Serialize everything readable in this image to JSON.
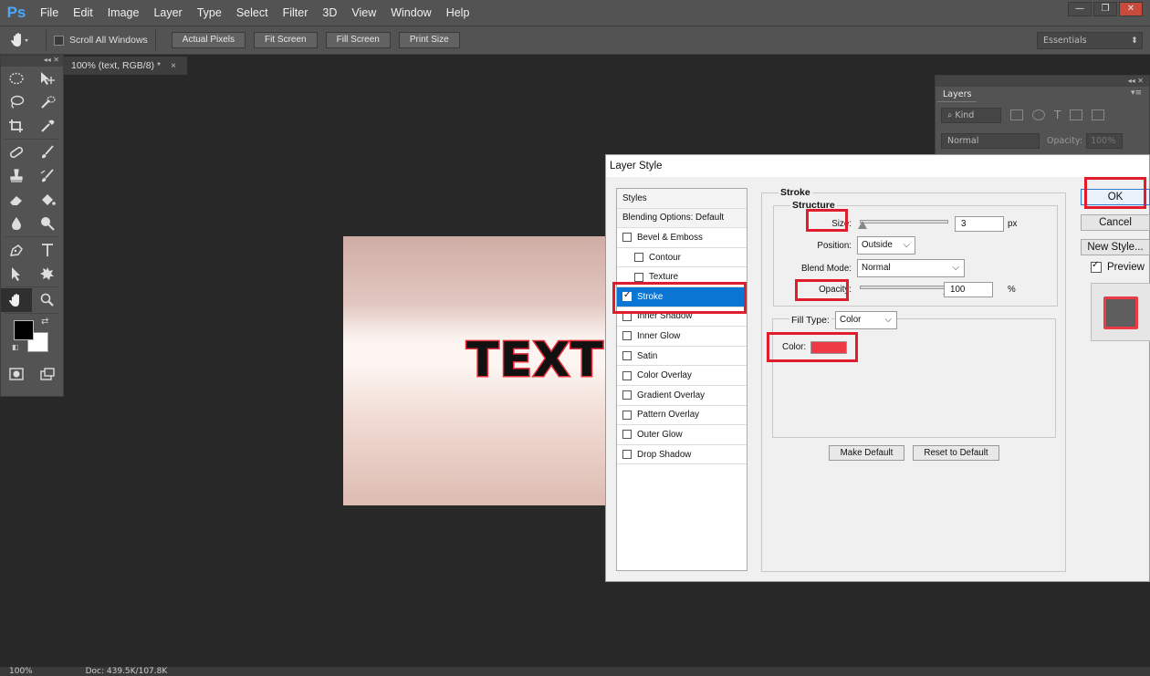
{
  "app": {
    "logo": "Ps"
  },
  "menu": [
    "File",
    "Edit",
    "Image",
    "Layer",
    "Type",
    "Select",
    "Filter",
    "3D",
    "View",
    "Window",
    "Help"
  ],
  "window_controls": {
    "minimize": "—",
    "restore": "❐",
    "close": "✕"
  },
  "options_bar": {
    "scroll_all_windows": "Scroll All Windows",
    "buttons": [
      "Actual Pixels",
      "Fit Screen",
      "Fill Screen",
      "Print Size"
    ],
    "workspace": "Essentials"
  },
  "document_tab": {
    "title": "100% (text, RGB/8) *",
    "close": "×"
  },
  "canvas": {
    "text": "TEXT",
    "stroke_color": "#e52e3a"
  },
  "layers_panel": {
    "title": "Layers",
    "kind": "Kind",
    "blend_mode": "Normal",
    "opacity_label": "Opacity:",
    "opacity_value": "100%"
  },
  "status_bar": {
    "zoom": "100%",
    "doc": "Doc: 439.5K/107.8K"
  },
  "dialog": {
    "title": "Layer Style",
    "styles": [
      {
        "label": "Styles",
        "type": "head"
      },
      {
        "label": "Blending Options: Default",
        "type": "head"
      },
      {
        "label": "Bevel & Emboss",
        "type": "check",
        "checked": false
      },
      {
        "label": "Contour",
        "type": "sub",
        "checked": false
      },
      {
        "label": "Texture",
        "type": "sub",
        "checked": false
      },
      {
        "label": "Stroke",
        "type": "check",
        "checked": true,
        "selected": true
      },
      {
        "label": "Inner Shadow",
        "type": "check",
        "checked": false
      },
      {
        "label": "Inner Glow",
        "type": "check",
        "checked": false
      },
      {
        "label": "Satin",
        "type": "check",
        "checked": false
      },
      {
        "label": "Color Overlay",
        "type": "check",
        "checked": false
      },
      {
        "label": "Gradient Overlay",
        "type": "check",
        "checked": false
      },
      {
        "label": "Pattern Overlay",
        "type": "check",
        "checked": false
      },
      {
        "label": "Outer Glow",
        "type": "check",
        "checked": false
      },
      {
        "label": "Drop Shadow",
        "type": "check",
        "checked": false
      }
    ],
    "stroke": {
      "group_title": "Stroke",
      "structure_title": "Structure",
      "size_label": "Size:",
      "size_value": "3",
      "size_unit": "px",
      "position_label": "Position:",
      "position_value": "Outside",
      "blend_mode_label": "Blend Mode:",
      "blend_mode_value": "Normal",
      "opacity_label": "Opacity:",
      "opacity_value": "100",
      "opacity_unit": "%",
      "fill_type_label": "Fill Type:",
      "fill_type_value": "Color",
      "color_label": "Color:",
      "color_value": "#ec3b44",
      "make_default": "Make Default",
      "reset_default": "Reset to Default"
    },
    "buttons": {
      "ok": "OK",
      "cancel": "Cancel",
      "new_style": "New Style..."
    },
    "preview_label": "Preview",
    "preview_checked": true
  },
  "highlight_color": "#e11c2c"
}
